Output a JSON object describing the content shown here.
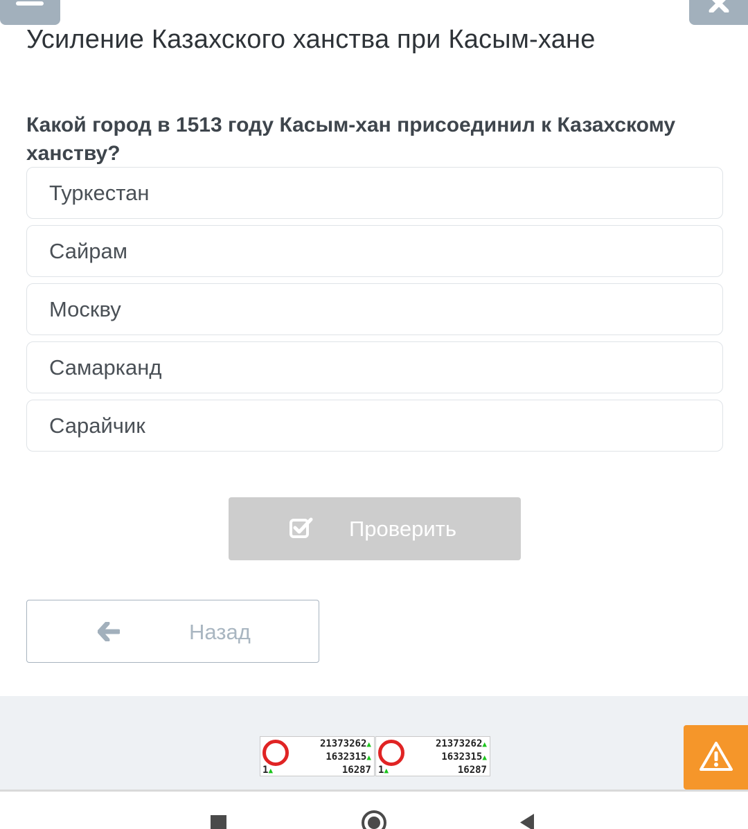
{
  "header": {
    "menu_icon": "hamburger-icon",
    "close_icon": "close-icon",
    "lesson_title": "Усиление Казахского ханства при Касым-хане"
  },
  "quiz": {
    "question": "Какой город в 1513 году Касым-хан присоединил к Казахскому ханству?",
    "options": [
      {
        "label": "Туркестан"
      },
      {
        "label": "Сайрам"
      },
      {
        "label": "Москву"
      },
      {
        "label": "Самарканд"
      },
      {
        "label": "Сарайчик"
      }
    ],
    "check_button": {
      "label": "Проверить",
      "icon": "checkbox-check-icon",
      "state": "disabled"
    },
    "back_button": {
      "label": "Назад",
      "icon": "arrow-left-icon"
    }
  },
  "footer": {
    "counters": [
      {
        "one": "1",
        "v1": "21373262",
        "v2": "1632315",
        "v3": "16287"
      },
      {
        "one": "1",
        "v1": "21373262",
        "v2": "1632315",
        "v3": "16287"
      }
    ],
    "report_icon": "warning-icon"
  },
  "system_nav": {
    "recents_icon": "square-icon",
    "home_icon": "circle-icon",
    "back_icon": "triangle-back-icon"
  },
  "colors": {
    "accent_gray": "#a2b0bc",
    "warning": "#f5962a",
    "button_disabled": "#cdcdcd"
  }
}
